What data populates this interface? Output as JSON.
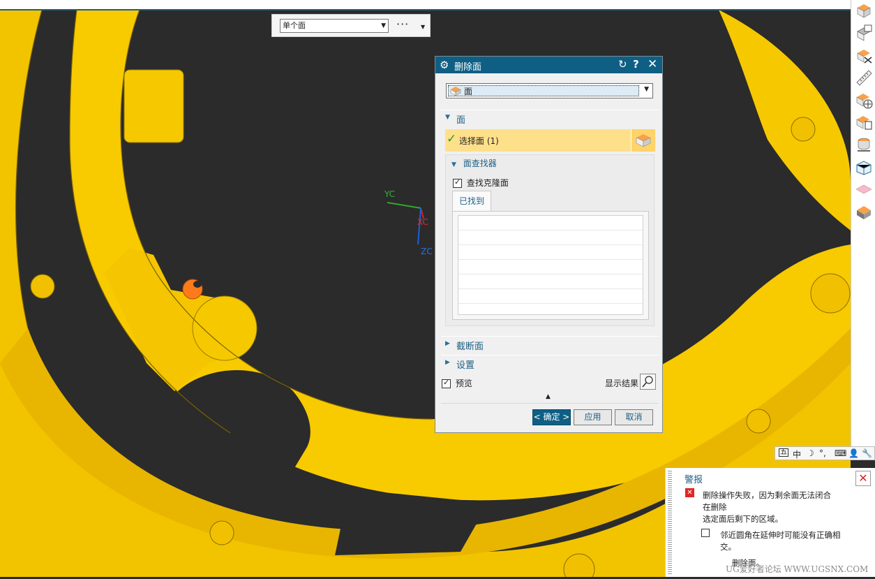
{
  "selection_bar": {
    "filter_value": "单个面",
    "more_label": "···"
  },
  "triad": {
    "yc": "YC",
    "xc": "XC",
    "zc": "ZC"
  },
  "dialog": {
    "title": "删除面",
    "type_value": "面",
    "section_face": "面",
    "select_face_label": "选择面 (1)",
    "face_finder_label": "面查找器",
    "find_clone_label": "查找克隆面",
    "find_clone_checked": true,
    "tab_found": "已找到",
    "section_cut": "截断面",
    "section_settings": "设置",
    "preview_label": "预览",
    "preview_checked": true,
    "show_result_label": "显示结果",
    "ok_label": "< 确定 >",
    "apply_label": "应用",
    "cancel_label": "取消"
  },
  "ime_bar": {
    "mode": "中"
  },
  "alert": {
    "title": "警报",
    "message_line1": "删除操作失败，因为剩余面无法闭合",
    "message_line2": "在删除",
    "message_line3": "选定面后剩下的区域。",
    "note_line1": "邻近圆角在延伸时可能没有正确相",
    "note_line2": "交。",
    "footer": "删除面。"
  },
  "watermark": "UG爱好者论坛 WWW.UGSNX.COM",
  "colors": {
    "part_yellow": "#f6c700",
    "title_blue": "#0f5f85",
    "highlight": "#ffe08a",
    "background": "#2b2b2b"
  },
  "icons": {
    "toolbar": [
      "block-icon",
      "drafting-icon",
      "edit-body-icon",
      "measure-icon",
      "move-object-icon",
      "copy-icon",
      "assembly-icon",
      "mesh-icon",
      "plane-icon",
      "solid-icon"
    ]
  }
}
